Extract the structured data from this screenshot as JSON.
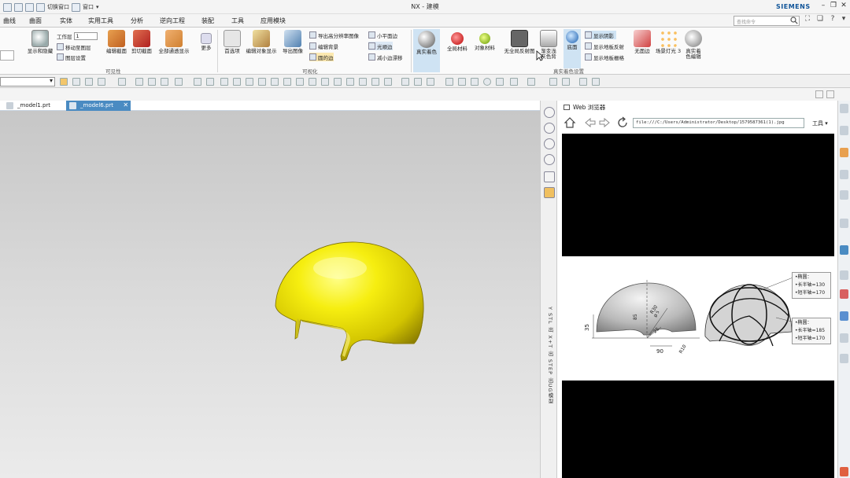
{
  "title_bar": {
    "switch_window": "切换窗口",
    "window_menu": "窗口",
    "app_title": "NX - 建模",
    "brand": "SIEMENS"
  },
  "menu": {
    "items": [
      "曲线",
      "曲面",
      "实体",
      "实用工具",
      "分析",
      "逆向工程",
      "装配",
      "工具",
      "应用模块"
    ],
    "search_placeholder": "查找命令"
  },
  "ribbon": {
    "show_hide": "显示和隐藏",
    "work_layer_label": "工作层",
    "work_layer_value": "1",
    "move_to_layer": "移动至图层",
    "layer_settings": "图层设置",
    "edit_section": "编辑截面",
    "clip_section": "剪切截面",
    "all_pass_display": "全部通透显示",
    "more": "更多",
    "visibility_group": "可见性",
    "preferences": "首选项",
    "edit_object_display": "编辑对象显示",
    "export_image": "导出图像",
    "export_hires_image": "导出高分辨率图像",
    "edit_background": "编辑背景",
    "circle_edge": "圆的边",
    "small_plane_edge": "小平面边",
    "smooth_edge": "光顺边",
    "reduce_jaggies": "减小边漂移",
    "visualization_group": "可视化",
    "true_shading": "真实着色",
    "global_material": "全局材料",
    "object_material": "对象材料",
    "no_global_reflection": "无全局反射图",
    "gradient_bg_1": "渐变浅",
    "gradient_bg_2": "灰色背",
    "floor": "底面",
    "show_shadow": "显示阴影",
    "show_floor_reflection": "显示地板反射",
    "show_floor_grid": "显示地板栅格",
    "no_edges": "无面边",
    "scene_light": "场景灯光 3",
    "true_shading_editor_1": "真实着",
    "true_shading_editor_2": "色编辑",
    "true_shading_settings_group": "真实着色设置"
  },
  "tabs": [
    {
      "label": "_model1.prt",
      "active": false
    },
    {
      "label": "_model6.prt",
      "active": true
    }
  ],
  "resource_bar": {
    "vertical_label": "Y STL 出 X+T 出 STEP 出UG模型"
  },
  "browser": {
    "title": "Web 浏览器",
    "url": "file:///C:/Users/Administrator/Desktop/1579587361(1).jpg",
    "tools_label": "工具",
    "drawing": {
      "dim_35": "35",
      "dim_85": "85",
      "dim_r30": "R30",
      "dim_25": "25",
      "dim_r10": "R10",
      "dim_90": "90",
      "dim_phi": "Ø 5",
      "legend_a_title": "•椭圆：",
      "legend_a_long": "•长半轴=130",
      "legend_a_short": "•短半轴=170",
      "legend_b_title": "•椭圆：",
      "legend_b_long": "•长半轴=185",
      "legend_b_short": "•短半轴=170"
    }
  },
  "colors": {
    "active_tab": "#4a8bc2",
    "helmet": "#f2ea00",
    "brand": "#115599"
  }
}
